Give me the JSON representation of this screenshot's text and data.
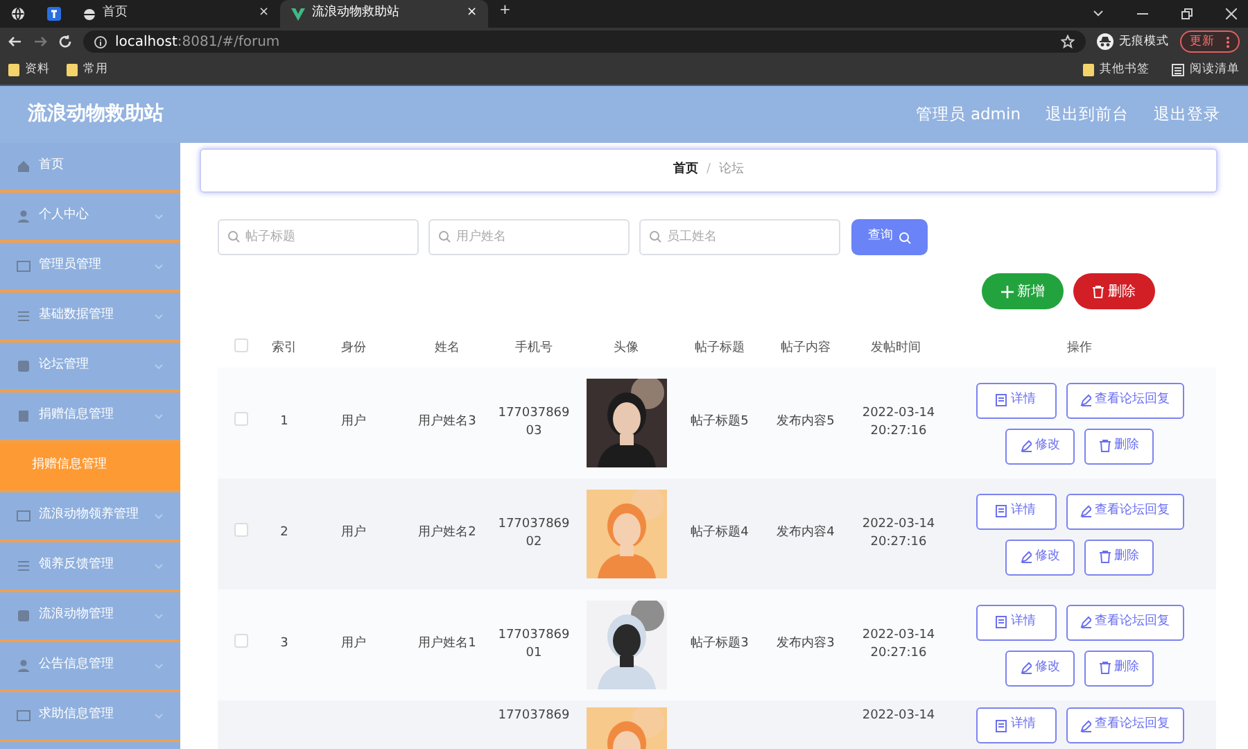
{
  "browser": {
    "tabs": [
      {
        "label": "首页",
        "selected": false,
        "close": "×"
      },
      {
        "label": "流浪动物救助站",
        "selected": true,
        "close": "×"
      }
    ],
    "new_tab": "+",
    "address": {
      "host": "localhost",
      "path": ":8081/#/forum"
    },
    "incognito": "无痕模式",
    "update_button": "更新",
    "bookmarks": [
      "资料",
      "常用"
    ],
    "bookmarks_right": [
      "其他书签",
      "阅读清单"
    ]
  },
  "header": {
    "title": "流浪动物救助站",
    "links": [
      "管理员 admin",
      "退出到前台",
      "退出登录"
    ]
  },
  "sidebar": {
    "items": [
      {
        "label": "首页",
        "kind": "link"
      },
      {
        "label": "个人中心",
        "kind": "menu"
      },
      {
        "label": "管理员管理",
        "kind": "menu"
      },
      {
        "label": "基础数据管理",
        "kind": "menu"
      },
      {
        "label": "论坛管理",
        "kind": "menu"
      },
      {
        "label": "捐赠信息管理",
        "kind": "menu",
        "children": [
          {
            "label": "捐赠信息管理",
            "selected": true
          }
        ]
      },
      {
        "label": "流浪动物领养管理",
        "kind": "menu"
      },
      {
        "label": "领养反馈管理",
        "kind": "menu"
      },
      {
        "label": "流浪动物管理",
        "kind": "menu"
      },
      {
        "label": "公告信息管理",
        "kind": "menu"
      },
      {
        "label": "求助信息管理",
        "kind": "menu"
      }
    ]
  },
  "breadcrumb": [
    "首页",
    "论坛"
  ],
  "breadcrumb_separator": "/",
  "search": {
    "fields": [
      {
        "placeholder": "帖子标题"
      },
      {
        "placeholder": "用户姓名"
      },
      {
        "placeholder": "员工姓名"
      }
    ],
    "button": "查询"
  },
  "actions": {
    "add": "新增",
    "delete": "删除"
  },
  "table": {
    "select_all": {
      "checked": false
    },
    "columns": [
      "索引",
      "身份",
      "姓名",
      "手机号",
      "头像",
      "帖子标题",
      "帖子内容",
      "发帖时间",
      "操作"
    ],
    "rows": [
      {
        "checked": false,
        "index": "1",
        "role": "用户",
        "name": "用户姓名3",
        "phone": "17703786903",
        "avatar": {
          "kind": "picture"
        },
        "title": "帖子标题5",
        "content": "发布内容5",
        "time": "2022-03-14 20:27:16",
        "buttons": [
          "详情",
          "查看论坛回复",
          "修改",
          "删除"
        ]
      },
      {
        "checked": false,
        "index": "2",
        "role": "用户",
        "name": "用户姓名2",
        "phone": "17703786902",
        "avatar": {
          "kind": "picture"
        },
        "title": "帖子标题4",
        "content": "发布内容4",
        "time": "2022-03-14 20:27:16",
        "buttons": [
          "详情",
          "查看论坛回复",
          "修改",
          "删除"
        ]
      },
      {
        "checked": false,
        "index": "3",
        "role": "用户",
        "name": "用户姓名1",
        "phone": "17703786901",
        "avatar": {
          "kind": "picture"
        },
        "title": "帖子标题3",
        "content": "发布内容3",
        "time": "2022-03-14 20:27:16",
        "buttons": [
          "详情",
          "查看论坛回复",
          "修改",
          "删除"
        ]
      },
      {
        "phone": "177037869",
        "avatar": {
          "kind": "picture"
        },
        "time": "2022-03-14",
        "buttons": [
          "详情",
          "查看论坛回复"
        ]
      }
    ]
  }
}
